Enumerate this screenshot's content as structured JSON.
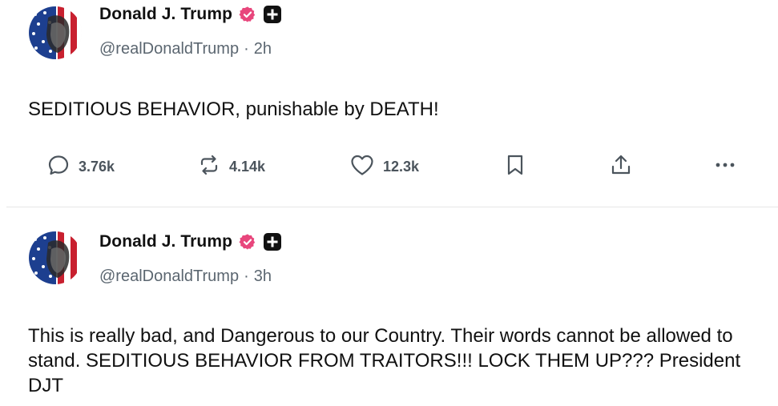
{
  "colors": {
    "verified_badge": "#e8467c",
    "text": "#111111",
    "muted": "#5b6670",
    "divider": "#e6e6e6"
  },
  "posts": [
    {
      "author": {
        "display_name": "Donald J. Trump",
        "handle": "@realDonaldTrump",
        "badges": [
          "verified-badge-icon",
          "plus-icon"
        ]
      },
      "time": "2h",
      "separator": "·",
      "text": "SEDITIOUS BEHAVIOR, punishable by DEATH!",
      "actions": {
        "replies": "3.76k",
        "reposts": "4.14k",
        "likes": "12.3k",
        "icons": [
          "reply-icon",
          "repost-icon",
          "like-icon",
          "bookmark-icon",
          "share-icon",
          "more-icon"
        ]
      }
    },
    {
      "author": {
        "display_name": "Donald J. Trump",
        "handle": "@realDonaldTrump",
        "badges": [
          "verified-badge-icon",
          "plus-icon"
        ]
      },
      "time": "3h",
      "separator": "·",
      "text": "This is really bad, and Dangerous to our Country. Their words cannot be allowed to stand. SEDITIOUS BEHAVIOR FROM TRAITORS!!! LOCK THEM UP??? President DJT"
    }
  ]
}
